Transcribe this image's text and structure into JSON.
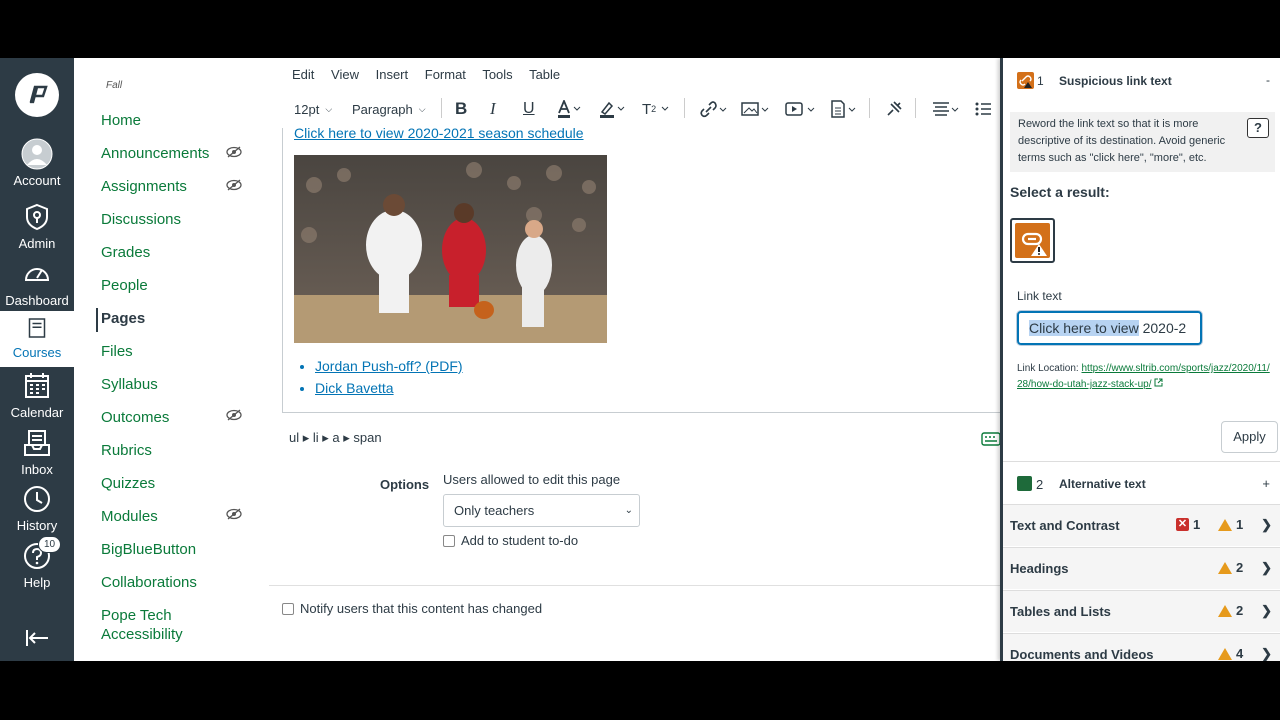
{
  "global_nav": {
    "items": [
      {
        "label": "Account",
        "icon": "account-icon"
      },
      {
        "label": "Admin",
        "icon": "admin-shield-icon"
      },
      {
        "label": "Dashboard",
        "icon": "dashboard-gauge-icon"
      },
      {
        "label": "Courses",
        "icon": "courses-book-icon"
      },
      {
        "label": "Calendar",
        "icon": "calendar-icon"
      },
      {
        "label": "Inbox",
        "icon": "inbox-icon"
      },
      {
        "label": "History",
        "icon": "history-clock-icon"
      },
      {
        "label": "Help",
        "icon": "help-icon"
      }
    ],
    "help_badge": "10"
  },
  "course_nav": {
    "term": "Fall",
    "items": [
      {
        "label": "Home"
      },
      {
        "label": "Announcements"
      },
      {
        "label": "Assignments"
      },
      {
        "label": "Discussions"
      },
      {
        "label": "Grades"
      },
      {
        "label": "People"
      },
      {
        "label": "Pages"
      },
      {
        "label": "Files"
      },
      {
        "label": "Syllabus"
      },
      {
        "label": "Outcomes"
      },
      {
        "label": "Rubrics"
      },
      {
        "label": "Quizzes"
      },
      {
        "label": "Modules"
      },
      {
        "label": "BigBlueButton"
      },
      {
        "label": "Collaborations"
      },
      {
        "label": "Pope Tech Accessibility"
      }
    ]
  },
  "editor": {
    "menu": [
      "Edit",
      "View",
      "Insert",
      "Format",
      "Tools",
      "Table"
    ],
    "font_size": "12pt",
    "block_format": "Paragraph",
    "top_link": "Click here to view 2020-2021 season schedule",
    "links": [
      "Jordan Push-off? (PDF)",
      "Dick Bavetta"
    ],
    "path": "ul ▸ li ▸ a ▸ span"
  },
  "options": {
    "label": "Options",
    "edit_label": "Users allowed to edit this page",
    "edit_value": "Only teachers",
    "todo_label": "Add to student to-do",
    "notify_label": "Notify users that this content has changed"
  },
  "panel": {
    "issue_count": "1",
    "issue_title": "Suspicious link text",
    "collapse": "-",
    "description": "Reword the link text so that it is more descriptive of its destination. Avoid generic terms such as \"click here\", \"more\", etc.",
    "help_button": "?",
    "select_result": "Select a result:",
    "link_text_label": "Link text",
    "link_text_highlight": "Click here to view",
    "link_text_rest": " 2020-2",
    "link_location_label": "Link Location: ",
    "link_location_url": "https://www.sltrib.com/sports/jazz/2020/11/28/how-do-utah-jazz-stack-up/",
    "apply": "Apply",
    "alt_count": "2",
    "alt_title": "Alternative text",
    "expand": "+",
    "categories": [
      {
        "name": "Text and Contrast",
        "errors": "1",
        "warnings": "1"
      },
      {
        "name": "Headings",
        "warnings": "2"
      },
      {
        "name": "Tables and Lists",
        "warnings": "2"
      },
      {
        "name": "Documents and Videos",
        "warnings": "4"
      }
    ]
  },
  "colors": {
    "nav_bg": "#2d3b45",
    "link_green": "#0a7a3a",
    "link_blue": "#0374b5",
    "warning": "#e69a1c",
    "error": "#c9302c"
  }
}
